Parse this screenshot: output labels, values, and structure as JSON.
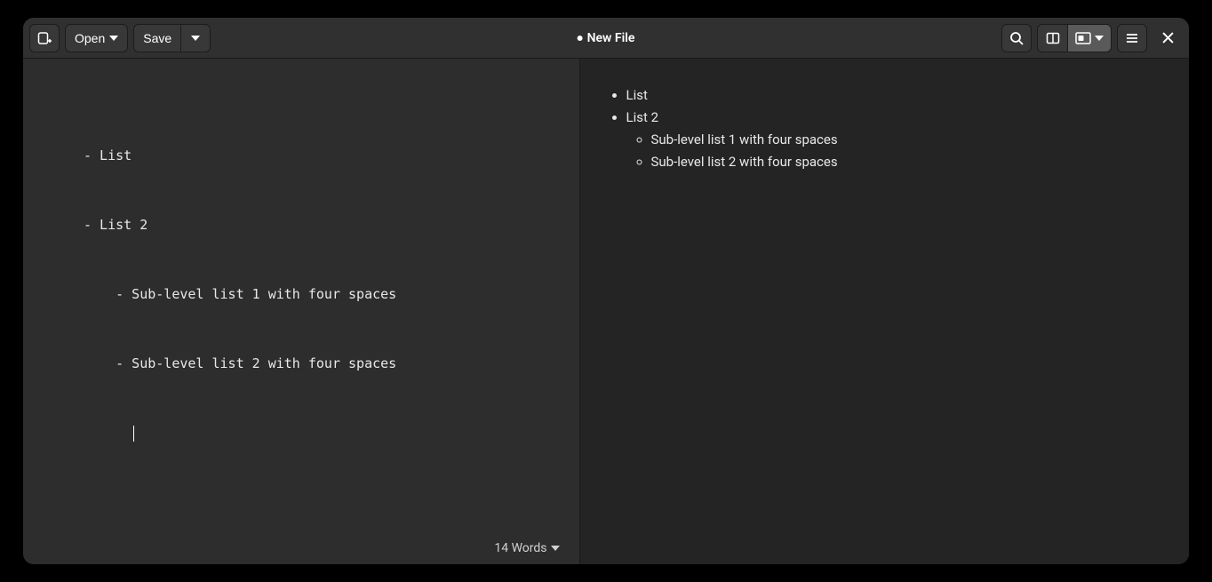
{
  "titlebar": {
    "open_label": "Open",
    "save_label": "Save",
    "file_title": "New File",
    "modified": true
  },
  "editor": {
    "lines": [
      "- List",
      "- List 2",
      "    - Sub-level list 1 with four spaces",
      "    - Sub-level list 2 with four spaces"
    ]
  },
  "status": {
    "word_count_label": "14 Words"
  },
  "preview": {
    "list": [
      {
        "text": "List",
        "children": []
      },
      {
        "text": "List 2",
        "children": [
          {
            "text": "Sub-level list 1 with four spaces"
          },
          {
            "text": "Sub-level list 2 with four spaces"
          }
        ]
      }
    ]
  }
}
